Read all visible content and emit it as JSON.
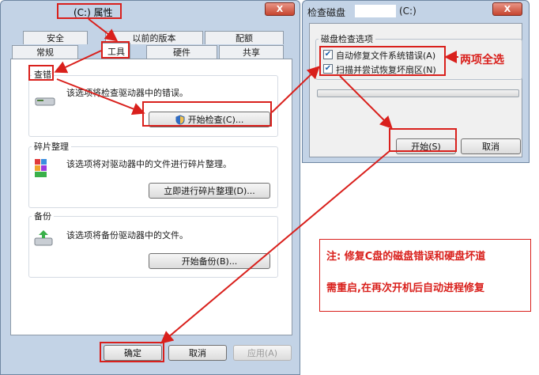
{
  "props_window": {
    "title": "(C:) 属性",
    "close_label": "X",
    "tabs_row1": [
      "安全",
      "以前的版本",
      "配额"
    ],
    "tabs_row2": [
      "常规",
      "工具",
      "硬件",
      "共享"
    ],
    "groups": {
      "check": {
        "title": "查错",
        "description": "该选项将检查驱动器中的错误。",
        "button": "开始检查(C)..."
      },
      "defrag": {
        "title": "碎片整理",
        "description": "该选项将对驱动器中的文件进行碎片整理。",
        "button": "立即进行碎片整理(D)..."
      },
      "backup": {
        "title": "备份",
        "description": "该选项将备份驱动器中的文件。",
        "button": "开始备份(B)..."
      }
    },
    "buttons": {
      "ok": "确定",
      "cancel": "取消",
      "apply": "应用(A)"
    }
  },
  "check_window": {
    "title": "检查磁盘",
    "drive": "(C:)",
    "close_label": "X",
    "group_title": "磁盘检查选项",
    "option1": "自动修复文件系统错误(A)",
    "option2": "扫描并尝试恢复坏扇区(N)",
    "option1_checked": true,
    "option2_checked": true,
    "progress": 0,
    "start_button": "开始(S)",
    "cancel_button": "取消"
  },
  "annotations": {
    "both_select": "两项全选",
    "note_line1": "注: 修复C盘的磁盘错误和硬盘坏道",
    "note_line2": "需重启,在再次开机后自动进程修复"
  },
  "colors": {
    "annotation_red": "#d9201c",
    "window_frame": "#c3d3e6",
    "panel_bg": "#ffffff"
  }
}
